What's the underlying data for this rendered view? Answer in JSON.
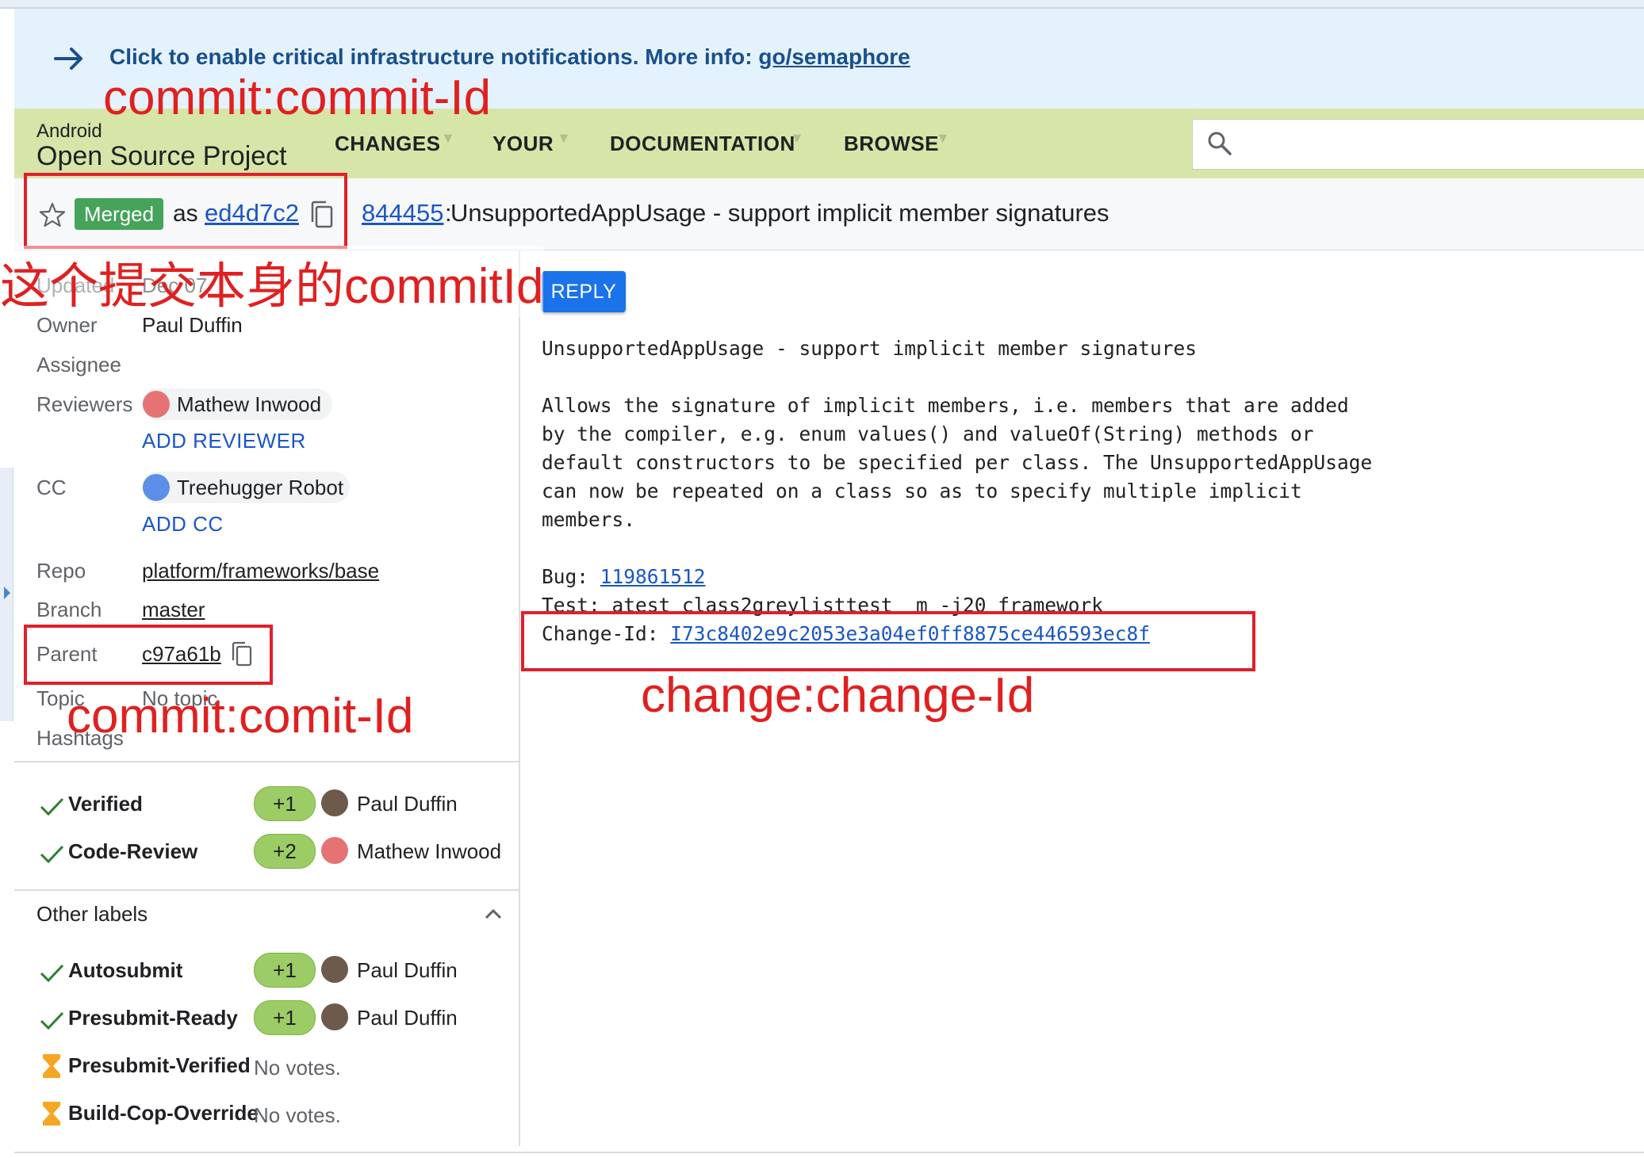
{
  "banner": {
    "text": "Click to enable critical infrastructure notifications. More info: ",
    "link": "go/semaphore"
  },
  "header": {
    "brand_small": "Android",
    "brand_big": "Open Source Project",
    "nav": [
      "CHANGES",
      "YOUR",
      "DOCUMENTATION",
      "BROWSE"
    ]
  },
  "change": {
    "status": "Merged",
    "as_label": "as",
    "commit": "ed4d7c2",
    "number": "844455",
    "separator": ":",
    "title": "UnsupportedAppUsage - support implicit member signatures"
  },
  "info": {
    "updated_label": "Updated",
    "updated_value": "Dec 07",
    "owner_label": "Owner",
    "owner_value": "Paul Duffin",
    "assignee_label": "Assignee",
    "reviewers_label": "Reviewers",
    "reviewer_name": "Mathew Inwood",
    "add_reviewer": "ADD REVIEWER",
    "cc_label": "CC",
    "cc_name": "Treehugger Robot",
    "add_cc": "ADD CC",
    "repo_label": "Repo",
    "repo_value": "platform/frameworks/base",
    "branch_label": "Branch",
    "branch_value": "master",
    "parent_label": "Parent",
    "parent_value": "c97a61b",
    "topic_label": "Topic",
    "topic_value": "No topic",
    "hashtags_label": "Hashtags"
  },
  "labels": [
    {
      "name": "Verified",
      "vote": "+1",
      "voter": "Paul Duffin"
    },
    {
      "name": "Code-Review",
      "vote": "+2",
      "voter": "Mathew Inwood"
    }
  ],
  "other_labels": {
    "title": "Other labels",
    "items": [
      {
        "name": "Autosubmit",
        "vote": "+1",
        "voter": "Paul Duffin"
      },
      {
        "name": "Presubmit-Ready",
        "vote": "+1",
        "voter": "Paul Duffin"
      },
      {
        "name": "Presubmit-Verified",
        "novotes": "No votes."
      },
      {
        "name": "Build-Cop-Override",
        "novotes": "No votes."
      }
    ]
  },
  "message": {
    "reply": "REPLY",
    "subject": "UnsupportedAppUsage - support implicit member signatures",
    "body": [
      "Allows the signature of implicit members, i.e. members that are added",
      "by the compiler, e.g. enum values() and valueOf(String) methods or",
      "default constructors to be specified per class. The UnsupportedAppUsage",
      "can now be repeated on a class so as to specify multiple implicit",
      "members."
    ],
    "bug_label": "Bug: ",
    "bug_value": "119861512",
    "test_line": "Test: atest class2greylisttest  m -j20 framework",
    "changeid_label": "Change-Id: ",
    "changeid_value": "I73c8402e9c2053e3a04ef0ff8875ce446593ec8f"
  },
  "annotations": {
    "top": "commit:commit-Id",
    "self": "这个提交本身的commitId",
    "parent": "commit:comit-Id",
    "changeid": "change:change-Id"
  },
  "colors": {
    "annotation": "#e02020",
    "merged": "#45a35a",
    "header": "#d6e6a8",
    "banner": "#e3f2fd",
    "vote": "#9ccc65"
  }
}
